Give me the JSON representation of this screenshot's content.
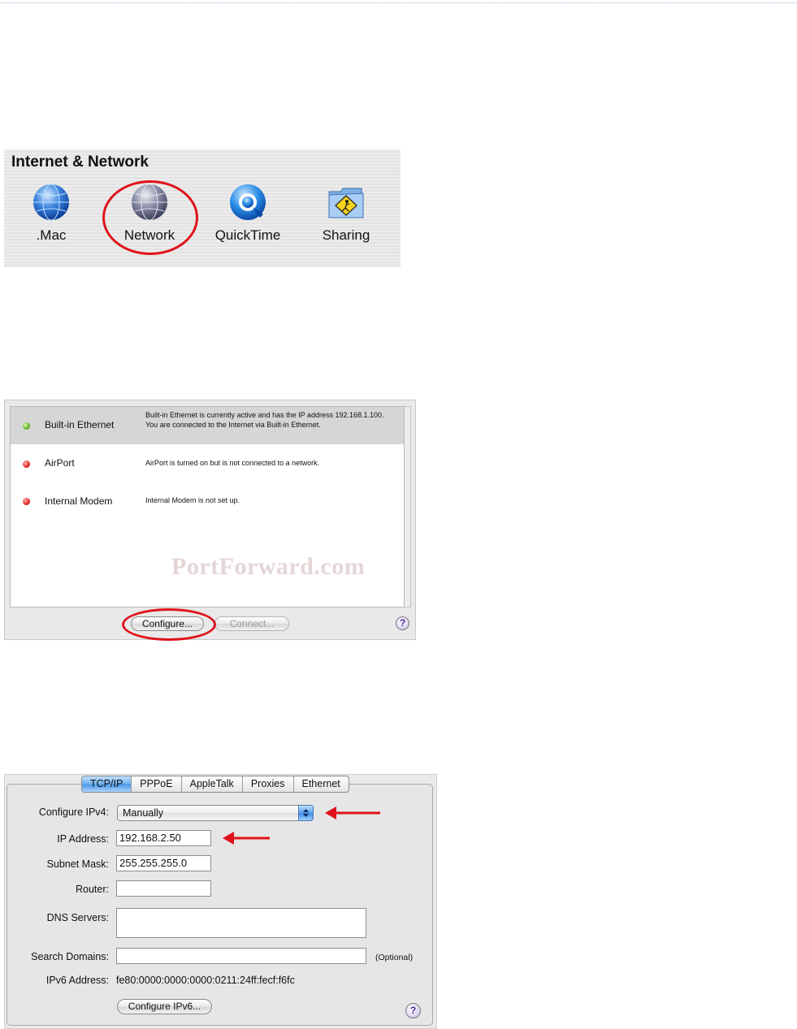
{
  "prefs": {
    "title": "Internet & Network",
    "items": [
      {
        "label": ".Mac",
        "icon": "dotmac-globe-icon"
      },
      {
        "label": "Network",
        "icon": "network-globe-icon"
      },
      {
        "label": "QuickTime",
        "icon": "quicktime-icon"
      },
      {
        "label": "Sharing",
        "icon": "sharing-folder-icon"
      }
    ],
    "highlight_color": "#e0131b"
  },
  "network_status": {
    "rows": [
      {
        "name": "Built-in Ethernet",
        "status": "green",
        "description": "Built-in Ethernet is currently active and has the IP address 192.168.1.100. You are connected to the Internet via Built-in Ethernet."
      },
      {
        "name": "AirPort",
        "status": "red",
        "description": "AirPort is turned on but is not connected to a network."
      },
      {
        "name": "Internal Modem",
        "status": "red",
        "description": "Internal Modem is not set up."
      }
    ],
    "watermark": "PortForward.com",
    "configure_button": "Configure...",
    "connect_button": "Connect...",
    "help": "?"
  },
  "tcpip": {
    "tabs": [
      "TCP/IP",
      "PPPoE",
      "AppleTalk",
      "Proxies",
      "Ethernet"
    ],
    "active_tab": "TCP/IP",
    "configure_ipv4_label": "Configure IPv4:",
    "configure_ipv4_value": "Manually",
    "ip_address_label": "IP Address:",
    "ip_address_value": "192.168.2.50",
    "subnet_mask_label": "Subnet Mask:",
    "subnet_mask_value": "255.255.255.0",
    "router_label": "Router:",
    "router_value": "",
    "dns_label": "DNS Servers:",
    "dns_value": "",
    "search_domains_label": "Search Domains:",
    "search_domains_value": "",
    "optional": "(Optional)",
    "ipv6_label": "IPv6 Address:",
    "ipv6_value": "fe80:0000:0000:0000:0211:24ff:fecf:f6fc",
    "configure_ipv6_button": "Configure IPv6...",
    "help": "?",
    "arrow_color": "#e0131b"
  }
}
